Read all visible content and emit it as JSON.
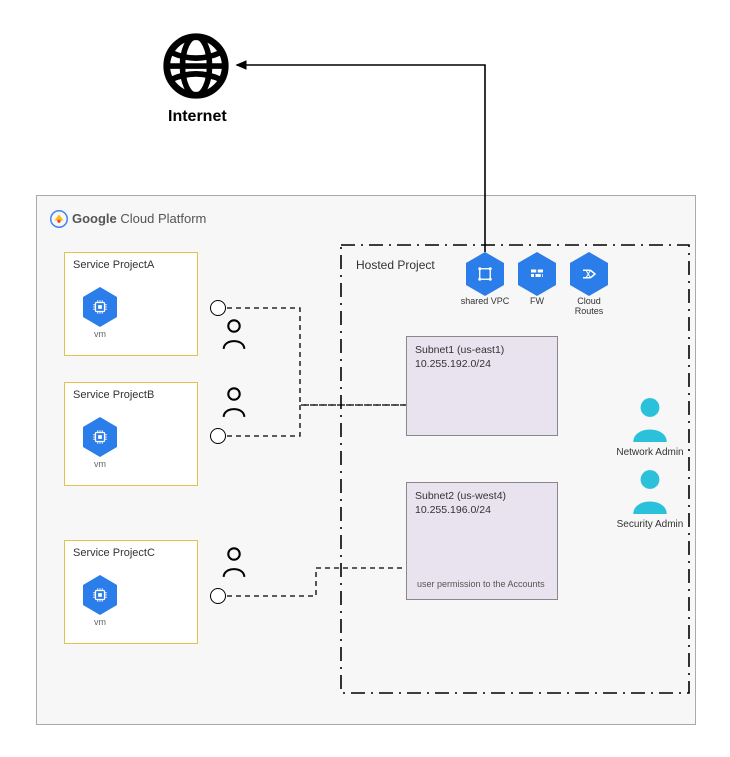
{
  "internet": {
    "label": "Internet"
  },
  "gcp": {
    "brand_prefix": "Google",
    "brand_rest": " Cloud Platform"
  },
  "service_projects": [
    {
      "title": "Service ProjectA",
      "vm_label": "vm"
    },
    {
      "title": "Service ProjectB",
      "vm_label": "vm"
    },
    {
      "title": "Service ProjectC",
      "vm_label": "vm"
    }
  ],
  "hosted": {
    "label": "Hosted Project",
    "resources": [
      {
        "name": "shared VPC",
        "icon": "vpc"
      },
      {
        "name": "FW",
        "icon": "fw"
      },
      {
        "name": "Cloud Routes",
        "icon": "routes"
      }
    ],
    "subnets": [
      {
        "name": "Subnet1 (us-east1)",
        "cidr": "10.255.192.0/24",
        "note": ""
      },
      {
        "name": "Subnet2 (us-west4)",
        "cidr": "10.255.196.0/24",
        "note": "user permission to the Accounts"
      }
    ],
    "admins": [
      {
        "role": "Network Admin"
      },
      {
        "role": "Security Admin"
      }
    ]
  },
  "colors": {
    "hex_blue": "#2b7de9",
    "person_cyan": "#2bc1da",
    "subnet_bg": "#e9e2ef",
    "project_border": "#e2c24e",
    "gcp_bg": "#f7f7f7"
  }
}
